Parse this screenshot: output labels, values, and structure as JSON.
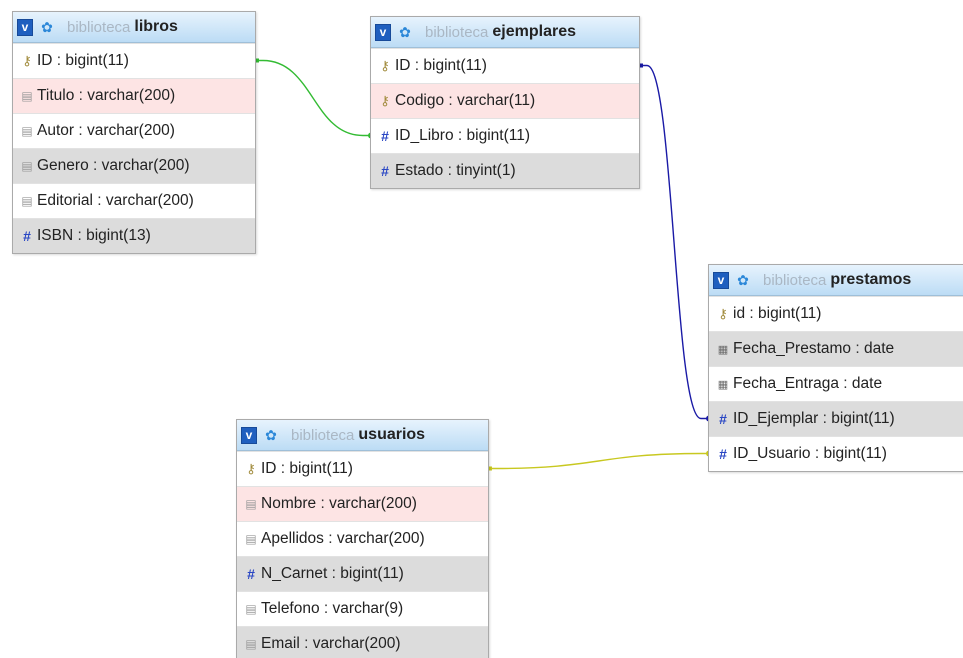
{
  "diagram": {
    "tables": [
      {
        "id": "libros",
        "db": "biblioteca",
        "name": "libros",
        "fields": [
          {
            "name": "ID",
            "type": "bigint(11)",
            "icon": "key-icon"
          },
          {
            "name": "Titulo",
            "type": "varchar(200)",
            "icon": "text-field-icon"
          },
          {
            "name": "Autor",
            "type": "varchar(200)",
            "icon": "text-field-icon"
          },
          {
            "name": "Genero",
            "type": "varchar(200)",
            "icon": "text-field-icon"
          },
          {
            "name": "Editorial",
            "type": "varchar(200)",
            "icon": "text-field-icon"
          },
          {
            "name": "ISBN",
            "type": "bigint(13)",
            "icon": "number-field-icon"
          }
        ]
      },
      {
        "id": "ejemplares",
        "db": "biblioteca",
        "name": "ejemplares",
        "fields": [
          {
            "name": "ID",
            "type": "bigint(11)",
            "icon": "key-icon"
          },
          {
            "name": "Codigo",
            "type": "varchar(11)",
            "icon": "key-icon"
          },
          {
            "name": "ID_Libro",
            "type": "bigint(11)",
            "icon": "number-field-icon"
          },
          {
            "name": "Estado",
            "type": "tinyint(1)",
            "icon": "number-field-icon"
          }
        ]
      },
      {
        "id": "prestamos",
        "db": "biblioteca",
        "name": "prestamos",
        "fields": [
          {
            "name": "id",
            "type": "bigint(11)",
            "icon": "key-icon"
          },
          {
            "name": "Fecha_Prestamo",
            "type": "date",
            "icon": "date-field-icon"
          },
          {
            "name": "Fecha_Entraga",
            "type": "date",
            "icon": "date-field-icon"
          },
          {
            "name": "ID_Ejemplar",
            "type": "bigint(11)",
            "icon": "number-field-icon"
          },
          {
            "name": "ID_Usuario",
            "type": "bigint(11)",
            "icon": "number-field-icon"
          }
        ]
      },
      {
        "id": "usuarios",
        "db": "biblioteca",
        "name": "usuarios",
        "fields": [
          {
            "name": "ID",
            "type": "bigint(11)",
            "icon": "key-icon"
          },
          {
            "name": "Nombre",
            "type": "varchar(200)",
            "icon": "text-field-icon"
          },
          {
            "name": "Apellidos",
            "type": "varchar(200)",
            "icon": "text-field-icon"
          },
          {
            "name": "N_Carnet",
            "type": "bigint(11)",
            "icon": "number-field-icon"
          },
          {
            "name": "Telefono",
            "type": "varchar(9)",
            "icon": "text-field-icon"
          },
          {
            "name": "Email",
            "type": "varchar(200)",
            "icon": "text-field-icon"
          }
        ]
      }
    ],
    "relations": [
      {
        "from": "libros.ID",
        "to": "ejemplares.ID_Libro",
        "color": "#33bb33"
      },
      {
        "from": "ejemplares.ID",
        "to": "prestamos.ID_Ejemplar",
        "color": "#1a1aa6"
      },
      {
        "from": "usuarios.ID",
        "to": "prestamos.ID_Usuario",
        "color": "#c8c820"
      }
    ]
  }
}
